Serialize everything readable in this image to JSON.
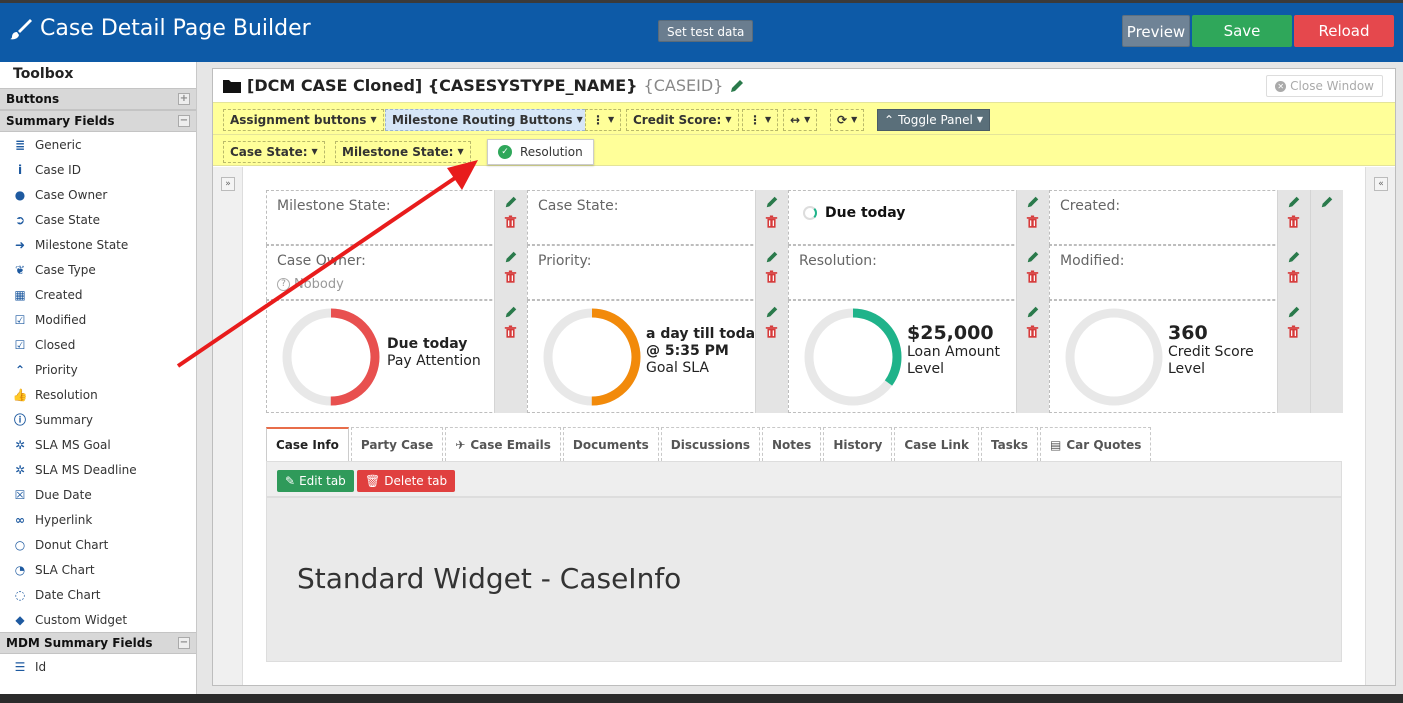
{
  "header": {
    "title": "Case Detail Page Builder",
    "set_test_data": "Set test data",
    "preview": "Preview",
    "save": "Save",
    "reload": "Reload"
  },
  "sidebar": {
    "title": "Toolbox",
    "sections": {
      "buttons": "Buttons",
      "summary_fields": "Summary Fields",
      "mdm_summary_fields": "MDM Summary Fields"
    },
    "items": [
      {
        "label": "Generic",
        "icon": "database-icon"
      },
      {
        "label": "Case ID",
        "icon": "info-icon"
      },
      {
        "label": "Case Owner",
        "icon": "user-icon"
      },
      {
        "label": "Case State",
        "icon": "circle-arrow-icon"
      },
      {
        "label": "Milestone State",
        "icon": "arrow-right-icon"
      },
      {
        "label": "Case Type",
        "icon": "leaf-icon"
      },
      {
        "label": "Created",
        "icon": "calendar-icon"
      },
      {
        "label": "Modified",
        "icon": "calendar-check-icon"
      },
      {
        "label": "Closed",
        "icon": "calendar-check-icon"
      },
      {
        "label": "Priority",
        "icon": "double-chevron-up-icon"
      },
      {
        "label": "Resolution",
        "icon": "thumbs-up-icon"
      },
      {
        "label": "Summary",
        "icon": "info-circle-icon"
      },
      {
        "label": "SLA MS Goal",
        "icon": "gear-icon"
      },
      {
        "label": "SLA MS Deadline",
        "icon": "gear-icon"
      },
      {
        "label": "Due Date",
        "icon": "calendar-x-icon"
      },
      {
        "label": "Hyperlink",
        "icon": "link-icon"
      },
      {
        "label": "Donut Chart",
        "icon": "ring-icon"
      },
      {
        "label": "SLA Chart",
        "icon": "clock-icon"
      },
      {
        "label": "Date Chart",
        "icon": "spinner-icon"
      },
      {
        "label": "Custom Widget",
        "icon": "tag-icon"
      }
    ],
    "mdm_items": [
      {
        "label": "Id",
        "icon": "list-icon"
      }
    ]
  },
  "main": {
    "title_bold": "[DCM CASE Cloned] {CASESYSTYPE_NAME}",
    "title_id": "{CASEID}",
    "close_window": "Close Window",
    "toolbar_row1": {
      "assignment_buttons": "Assignment buttons",
      "milestone_routing": "Milestone Routing Buttons",
      "credit_score": "Credit Score:",
      "toggle_panel": "Toggle Panel"
    },
    "toolbar_row2": {
      "case_state": "Case State:",
      "milestone_state": "Milestone State:",
      "resolution_pill": "Resolution"
    },
    "summary": {
      "row1": {
        "milestone_state": "Milestone State:",
        "case_state": "Case State:",
        "due_today": "Due today",
        "created": "Created:"
      },
      "row2": {
        "case_owner": "Case Owner:",
        "case_owner_value": "Nobody",
        "priority": "Priority:",
        "resolution": "Resolution:",
        "modified": "Modified:"
      },
      "donuts": [
        {
          "title": "Due today",
          "subtitle": "Pay Attention",
          "color": "#e8504f",
          "fraction": 0.5
        },
        {
          "title": "a day till today",
          "title2": "@ 5:35 PM",
          "subtitle": "Goal SLA",
          "color": "#f28a0a",
          "fraction": 0.5
        },
        {
          "title": "$25,000",
          "subtitle": "Loan Amount",
          "subtitle2": "Level",
          "color": "#1fb38a",
          "fraction": 0.35
        },
        {
          "title": "360",
          "subtitle": "Credit Score",
          "subtitle2": "Level",
          "color": "#e8e8e8",
          "fraction": 0
        }
      ]
    },
    "tabs": [
      "Case Info",
      "Party Case",
      "Case Emails",
      "Documents",
      "Discussions",
      "Notes",
      "History",
      "Case Link",
      "Tasks",
      "Car Quotes"
    ],
    "active_tab": "Case Info",
    "edit_tab": "Edit tab",
    "delete_tab": "Delete tab",
    "widget_title": "Standard Widget - CaseInfo"
  }
}
